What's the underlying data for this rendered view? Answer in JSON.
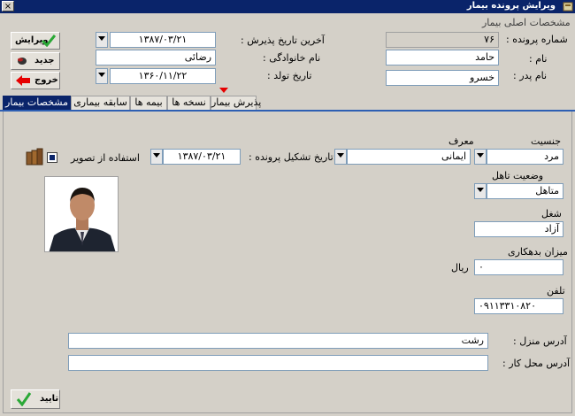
{
  "window": {
    "title": "ویرایش پرونده بیمار",
    "close_glyph": "×"
  },
  "buttons": {
    "edit": "ویرایش",
    "new": "جدید",
    "exit": "خروج",
    "confirm": "تایید"
  },
  "header": {
    "group_title": "مشخصات اصلی بیمار",
    "case_number_label": "شماره پرونده :",
    "case_number_value": "۷۶",
    "first_name_label": "نام :",
    "first_name_value": "حامد",
    "father_name_label": "نام پدر :",
    "father_name_value": "خسرو",
    "last_admission_label": "آخرین تاریخ پذیرش :",
    "last_admission_value": "۱۳۸۷/۰۳/۲۱",
    "family_name_label": "نام خانوادگی :",
    "family_name_value": "رضائی",
    "birth_date_label": "تاریخ تولد :",
    "birth_date_value": "۱۳۶۰/۱۱/۲۲"
  },
  "tabs": [
    {
      "label": "مشخصات بیمار",
      "active": true
    },
    {
      "label": "سابقه بیماری",
      "active": false
    },
    {
      "label": "بیمه ها",
      "active": false
    },
    {
      "label": "نسخه ها",
      "active": false
    },
    {
      "label": "پذیرش بیمار",
      "active": false
    }
  ],
  "details": {
    "gender_label": "جنسیت",
    "gender_value": "مرد",
    "referrer_label": "معرف",
    "referrer_value": "ایمانی",
    "file_date_label": "تاریخ تشکیل پرونده :",
    "file_date_value": "۱۳۸۷/۰۳/۲۱",
    "use_image_label": "استفاده از تصویر",
    "marital_label": "وضعیت تاهل",
    "marital_value": "متاهل",
    "job_label": "شغل",
    "job_value": "آزاد",
    "debt_label": "میزان بدهکاری",
    "debt_value": "۰",
    "debt_unit": "ریال",
    "phone_label": "تلفن",
    "phone_value": "۰۹۱۱۳۳۱۰۸۲۰",
    "home_address_label": "آدرس منزل :",
    "home_address_value": "رشت",
    "work_address_label": "آدرس محل کار :",
    "work_address_value": ""
  },
  "icons": [
    "check-icon",
    "dot-icon",
    "arrow-left-icon",
    "dropdown-arrow-icon",
    "books-icon",
    "photo-icon"
  ],
  "colors": {
    "titlebar": "#0a246a",
    "panel_bg": "#d4d0c8",
    "accent_tab": "#0a246a",
    "arrow_red": "#e60000",
    "check_green": "#2aa836"
  }
}
